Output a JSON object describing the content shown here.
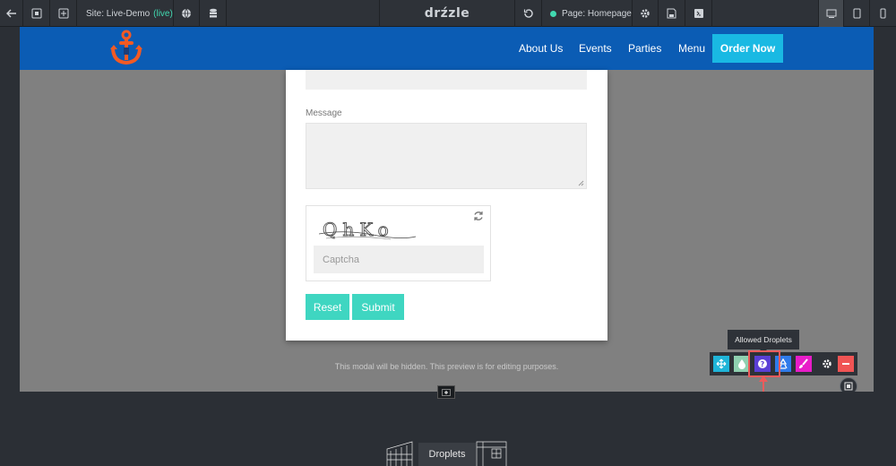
{
  "toolbar": {
    "site_label": "Site: Live-Demo",
    "site_status": "(live)",
    "brand": "drźzle",
    "page_label": "Page: Homepage"
  },
  "site": {
    "nav": [
      "About Us",
      "Events",
      "Parties",
      "Menu"
    ],
    "order_button": "Order Now"
  },
  "form": {
    "message_label": "Message",
    "captcha_text": "QhKo",
    "captcha_placeholder": "Captcha",
    "reset_label": "Reset",
    "submit_label": "Submit"
  },
  "modal_hint": "This modal will be hidden. This preview is for editing purposes.",
  "droplet_toolbar": {
    "tooltip": "Allowed Droplets",
    "buttons": [
      {
        "name": "move-icon",
        "color": "#1fb5d9"
      },
      {
        "name": "droplet-icon",
        "color": "#8fd0b0"
      },
      {
        "name": "question-icon",
        "color": "#5a3fd6"
      },
      {
        "name": "recycle-icon",
        "color": "#2f7bea"
      },
      {
        "name": "brush-icon",
        "color": "#e81cc8"
      },
      {
        "name": "gear-icon",
        "color": "#2e3238"
      },
      {
        "name": "minus-icon",
        "color": "#f05454"
      }
    ]
  },
  "footer": {
    "droplets_label": "Droplets"
  },
  "colors": {
    "header_blue": "#0b5cb4",
    "order_cyan": "#19b9e3",
    "button_teal": "#3fd6c1",
    "live_green": "#41d9b0",
    "highlight_red": "#ec5b5b"
  }
}
